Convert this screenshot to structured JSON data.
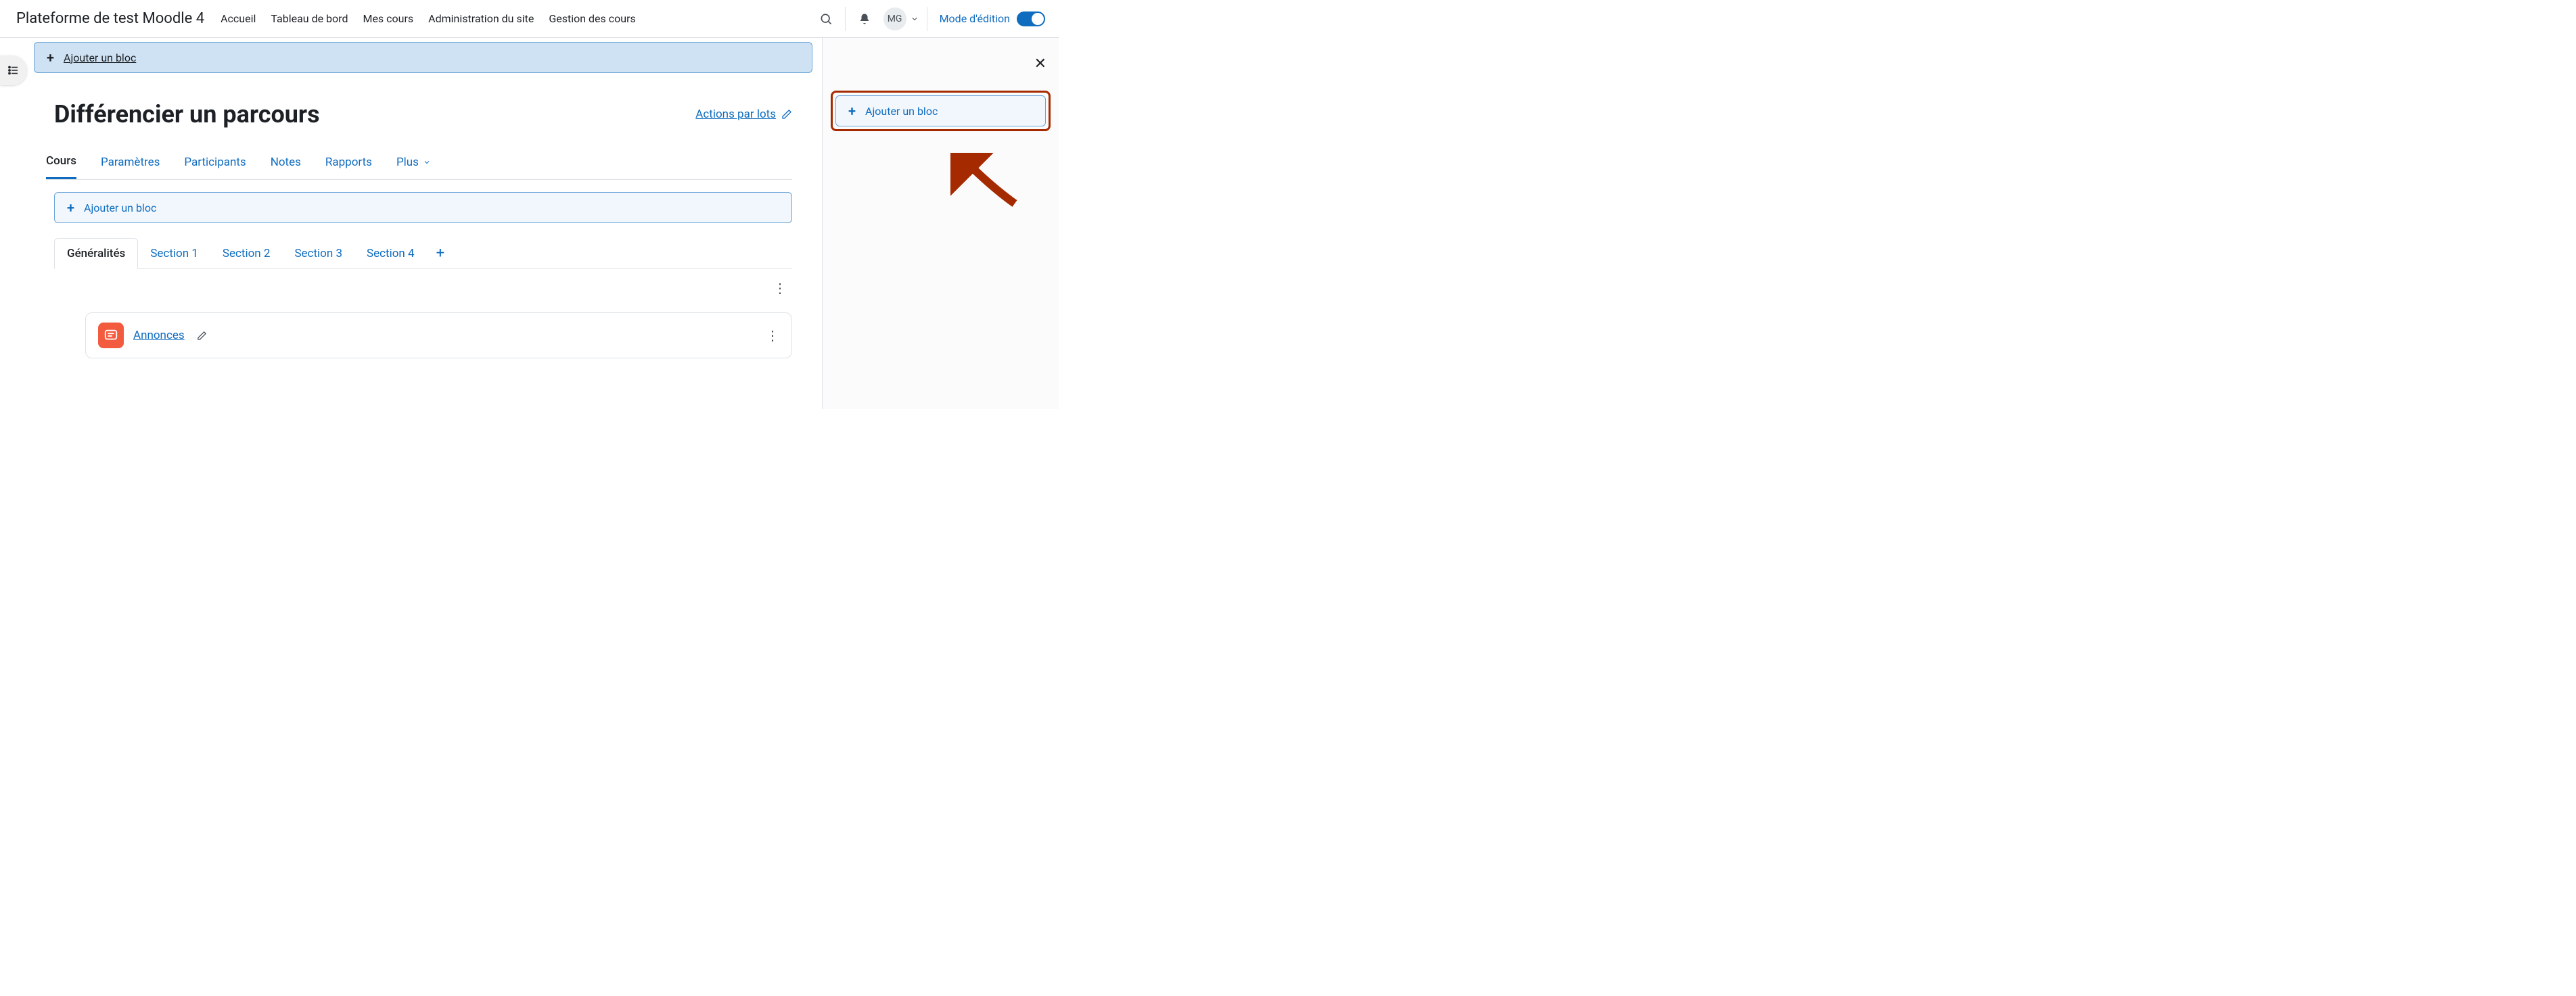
{
  "navbar": {
    "brand": "Plateforme de test Moodle 4",
    "links": [
      "Accueil",
      "Tableau de bord",
      "Mes cours",
      "Administration du site",
      "Gestion des cours"
    ],
    "user_initials": "MG",
    "edit_mode_label": "Mode d'édition"
  },
  "top_add_block": {
    "label": "Ajouter un bloc"
  },
  "right_add_block": {
    "label": "Ajouter un bloc"
  },
  "course": {
    "title": "Différencier un parcours",
    "bulk_actions": "Actions par lots",
    "nav": [
      "Cours",
      "Paramètres",
      "Participants",
      "Notes",
      "Rapports",
      "Plus"
    ],
    "add_block_label": "Ajouter un bloc",
    "section_tabs": [
      "Généralités",
      "Section 1",
      "Section 2",
      "Section 3",
      "Section 4"
    ],
    "activity": {
      "name": "Annonces"
    }
  }
}
